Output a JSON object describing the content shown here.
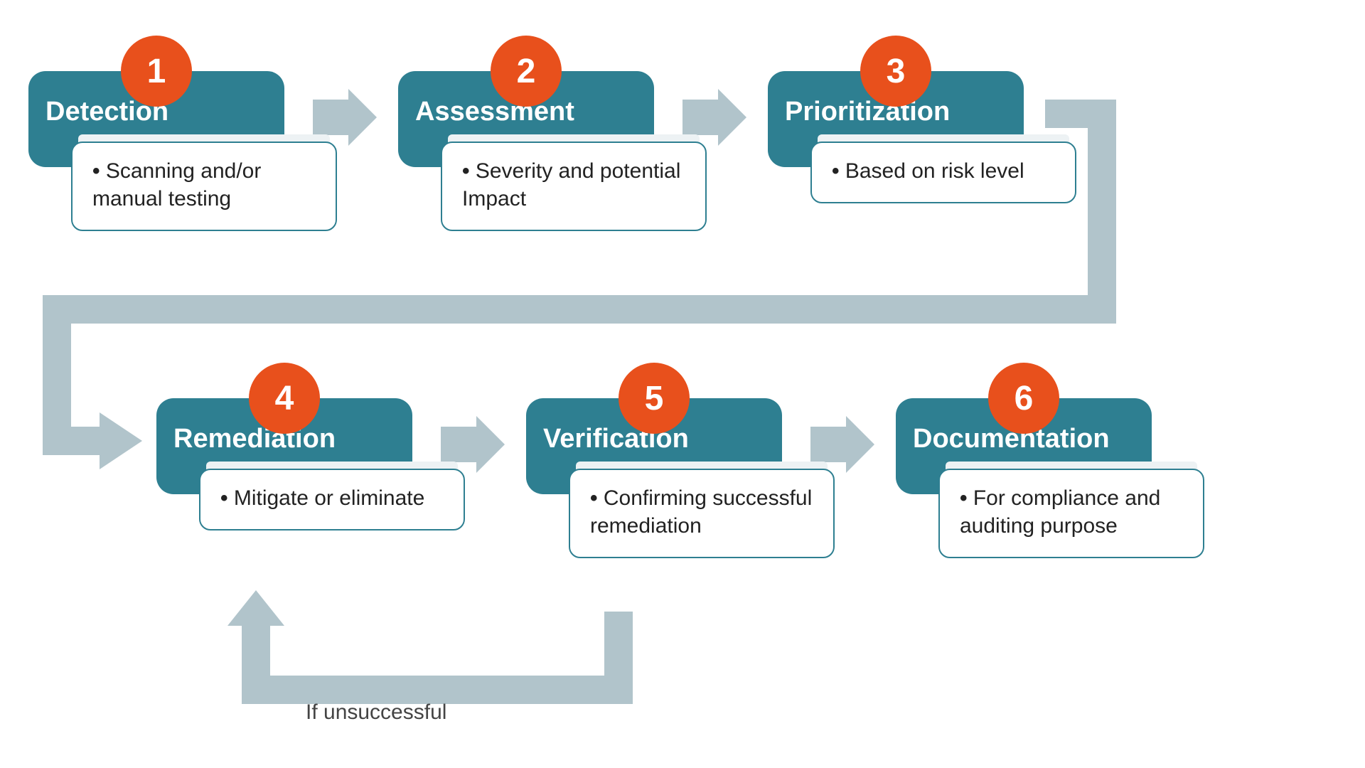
{
  "steps": [
    {
      "num": "1",
      "title": "Detection",
      "detail": "Scanning and/or manual testing"
    },
    {
      "num": "2",
      "title": "Assessment",
      "detail": "Severity and potential Impact"
    },
    {
      "num": "3",
      "title": "Prioritization",
      "detail": "Based on risk level"
    },
    {
      "num": "4",
      "title": "Remediation",
      "detail": "Mitigate or eliminate"
    },
    {
      "num": "5",
      "title": "Verification",
      "detail": "Confirming successful remediation"
    },
    {
      "num": "6",
      "title": "Documentation",
      "detail": "For compliance and auditing purpose"
    }
  ],
  "feedback_label": "If unsuccessful",
  "colors": {
    "teal": "#2e7f91",
    "orange": "#e8501c",
    "arrow": "#b1c4cb"
  }
}
